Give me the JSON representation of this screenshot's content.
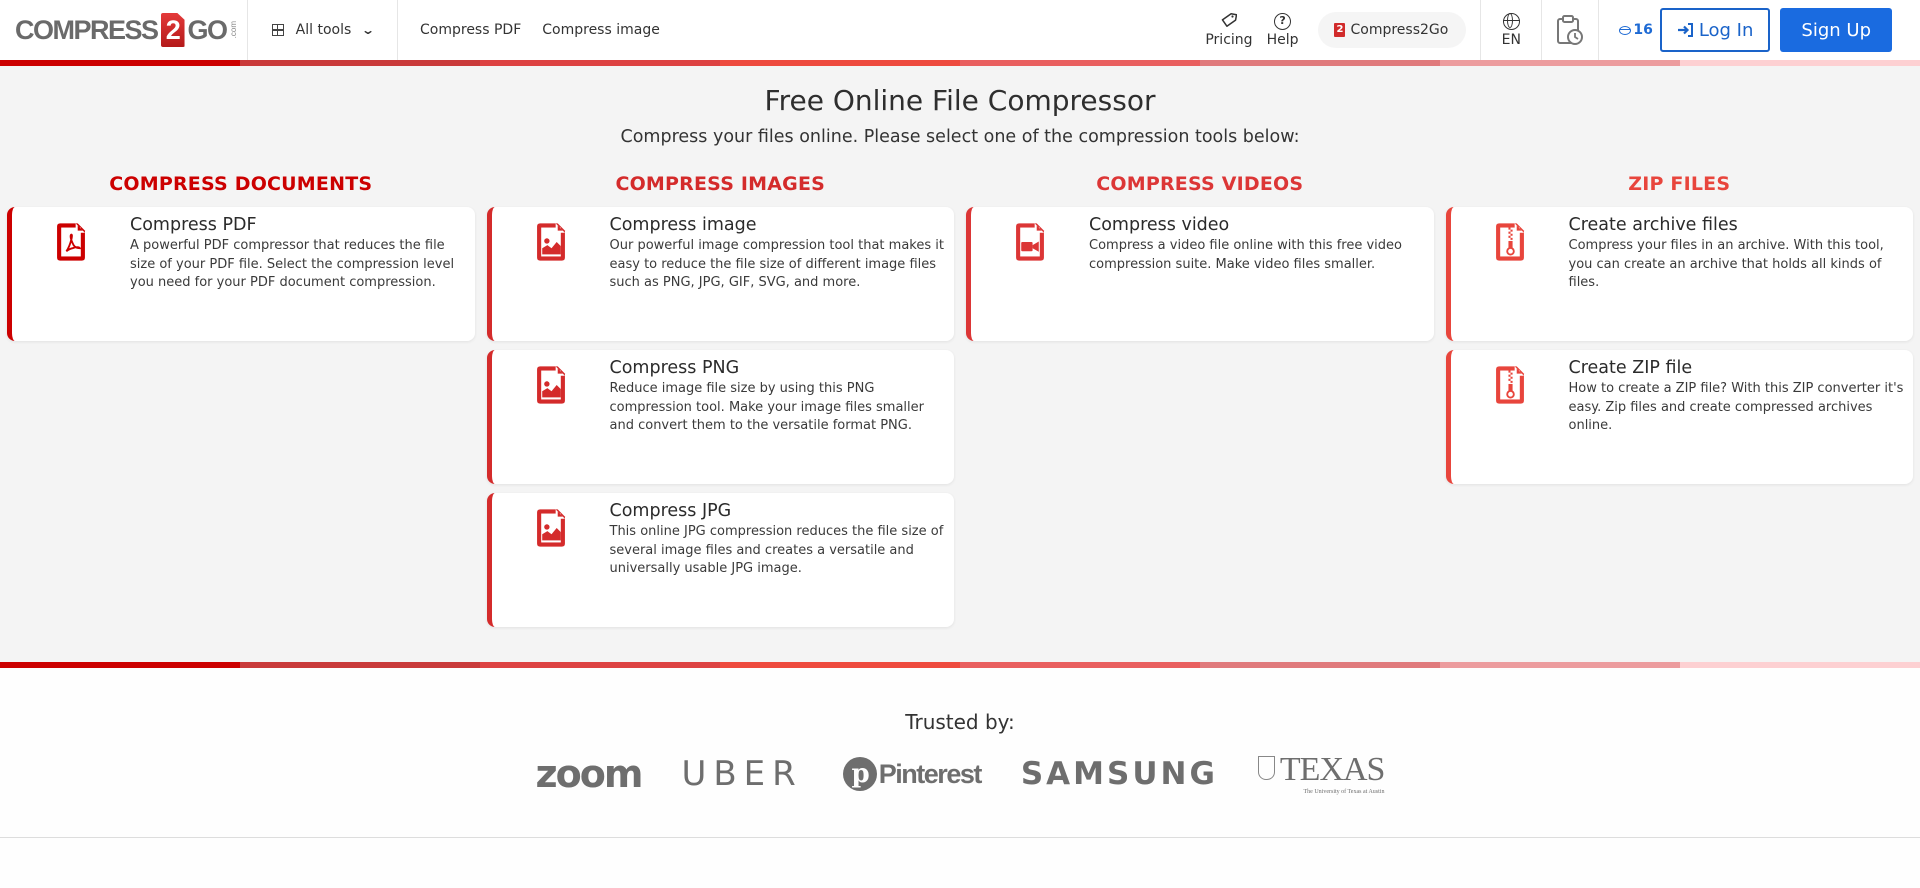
{
  "header": {
    "logo": {
      "text_left": "COMPRESS",
      "text_num": "2",
      "text_right": "GO",
      "text_com": ".com"
    },
    "all_tools_label": "All tools",
    "nav": [
      "Compress PDF",
      "Compress image"
    ],
    "pricing_label": "Pricing",
    "help_label": "Help",
    "brand_button_label": "Compress2Go",
    "language": "EN",
    "credits": "16",
    "login_label": "Log In",
    "signup_label": "Sign Up"
  },
  "stripe_colors": [
    "#cc0000",
    "#c93a3a",
    "#dd4242",
    "#ee4a3e",
    "#e95f5f",
    "#e07a7c",
    "#ec9c9e",
    "#fdd0d2"
  ],
  "main": {
    "title": "Free Online File Compressor",
    "subtitle": "Compress your files online. Please select one of the compression tools below:",
    "columns": [
      {
        "title": "COMPRESS DOCUMENTS",
        "color": "#cc0000",
        "cards": [
          {
            "icon": "pdf-file-icon",
            "title": "Compress PDF",
            "desc": "A powerful PDF compressor that reduces the file size of your PDF file. Select the compression level you need for your PDF document compression."
          }
        ]
      },
      {
        "title": "COMPRESS IMAGES",
        "color": "#d42b2b",
        "cards": [
          {
            "icon": "image-file-icon",
            "title": "Compress image",
            "desc": "Our powerful image compression tool that makes it easy to reduce the file size of different image files such as PNG, JPG, GIF, SVG, and more."
          },
          {
            "icon": "image-file-icon",
            "title": "Compress PNG",
            "desc": "Reduce image file size by using this PNG compression tool. Make your image files smaller and convert them to the versatile format PNG."
          },
          {
            "icon": "image-file-icon",
            "title": "Compress JPG",
            "desc": "This online JPG compression reduces the file size of several image files and creates a versatile and universally usable JPG image."
          }
        ]
      },
      {
        "title": "COMPRESS VIDEOS",
        "color": "#dc3636",
        "cards": [
          {
            "icon": "video-file-icon",
            "title": "Compress video",
            "desc": "Compress a video file online with this free video compression suite. Make video files smaller."
          }
        ]
      },
      {
        "title": "ZIP FILES",
        "color": "#e8453c",
        "cards": [
          {
            "icon": "zip-file-icon",
            "title": "Create archive files",
            "desc": "Compress your files in an archive. With this tool, you can create an archive that holds all kinds of files."
          },
          {
            "icon": "zip-file-icon",
            "title": "Create ZIP file",
            "desc": "How to create a ZIP file? With this ZIP converter it's easy. Zip files and create compressed archives online."
          }
        ]
      }
    ]
  },
  "trusted": {
    "title": "Trusted by:",
    "logos": {
      "zoom": "zoom",
      "uber": "UBER",
      "pinterest": "Pinterest",
      "samsung": "SAMSUNG",
      "texas": "TEXAS",
      "texas_sub": "The University of Texas at Austin"
    }
  }
}
